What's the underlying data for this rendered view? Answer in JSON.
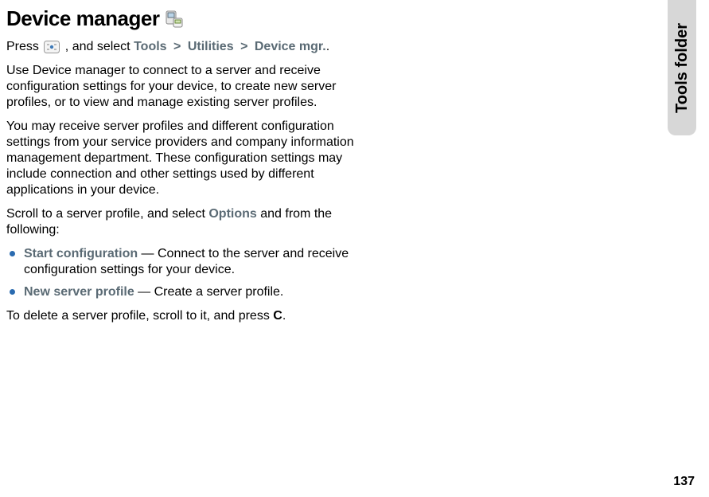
{
  "title": "Device manager",
  "sideTab": "Tools folder",
  "pageNumber": "137",
  "intro": {
    "press": "Press ",
    "andSelect": ", and select ",
    "path": [
      "Tools",
      "Utilities",
      "Device mgr."
    ],
    "sep": ">",
    "end": "."
  },
  "para1": "Use Device manager to connect to a server and receive configuration settings for your device, to create new server profiles, or to view and manage existing server profiles.",
  "para2": "You may receive server profiles and different configuration settings from your service providers and company information management department. These configuration settings may include connection and other settings used by different applications in your device.",
  "para3": {
    "t1": "Scroll to a server profile, and select ",
    "options": "Options",
    "t2": " and from the following:"
  },
  "bullets": [
    {
      "label": "Start configuration",
      "desc": " — Connect to the server and receive configuration settings for your device."
    },
    {
      "label": "New server profile",
      "desc": " — Create a server profile."
    }
  ],
  "para4": {
    "t1": "To delete a server profile, scroll to it, and press ",
    "key": "C",
    "t2": "."
  }
}
